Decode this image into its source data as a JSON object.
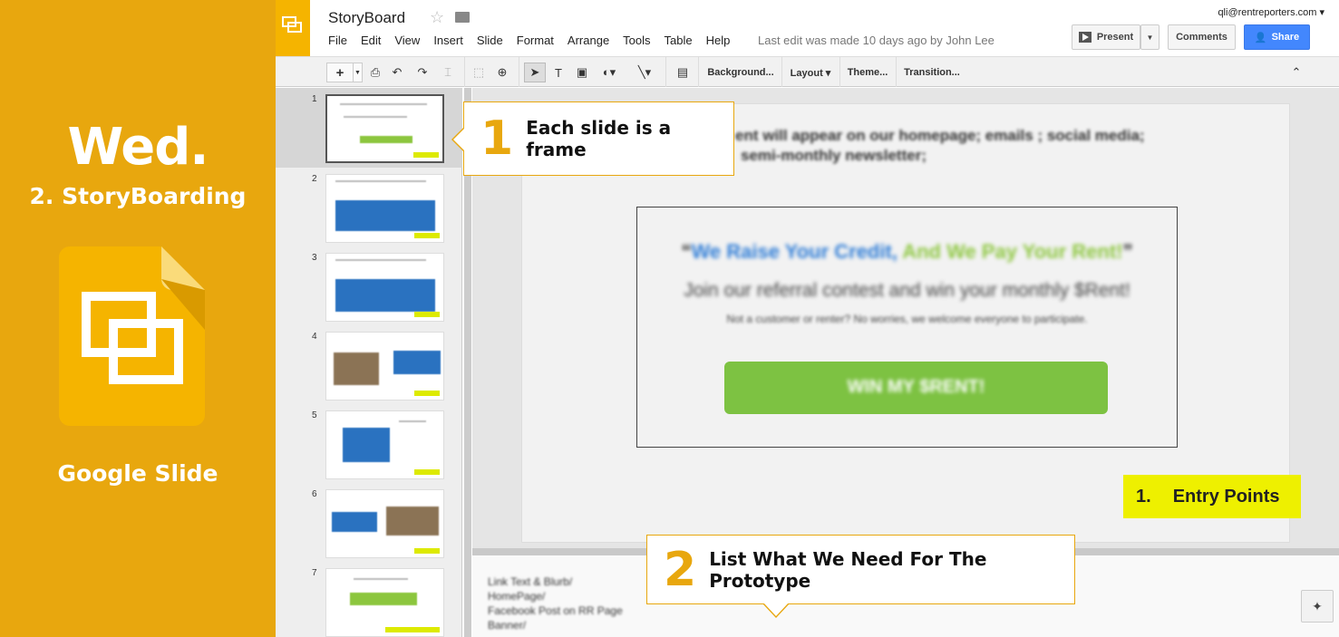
{
  "side": {
    "day": "Wed.",
    "subtitle": "2. StoryBoarding",
    "app_name": "Google Slide",
    "background": "#e8a70e"
  },
  "app": {
    "doc_title": "StoryBoard",
    "menu": [
      "File",
      "Edit",
      "View",
      "Insert",
      "Slide",
      "Format",
      "Arrange",
      "Tools",
      "Table",
      "Help"
    ],
    "last_edit": "Last edit was made 10 days ago by John Lee",
    "account": "qli@rentreporters.com ▾",
    "present_label": "Present",
    "comments_label": "Comments",
    "share_label": "Share",
    "share_color": "#4387fd"
  },
  "toolbar": {
    "add": "+",
    "background": "Background...",
    "layout": "Layout ▾",
    "theme": "Theme...",
    "transition": "Transition...",
    "collapse": "⌃"
  },
  "filmstrip": {
    "numbers": [
      "1",
      "2",
      "3",
      "4",
      "5",
      "6",
      "7"
    ]
  },
  "slide": {
    "heading_line1": "ent will appear on our homepage; emails ; social media;",
    "heading_line2": "semi-monthly newsletter;",
    "promo_headline_open": "“",
    "promo_headline_blue": "We Raise Your Credit,",
    "promo_headline_green": " And We Pay Your Rent!",
    "promo_headline_close": "”",
    "promo_sub": "Join our referral contest and win your monthly $Rent!",
    "promo_small": "Not a customer or renter? No worries, we welcome everyone to participate.",
    "promo_button": "WIN MY $RENT!",
    "entry_num": "1.",
    "entry_label": "Entry Points",
    "entry_color": "#eef000"
  },
  "notes": {
    "lines": [
      "Link Text & Blurb/",
      "HomePage/",
      "Facebook Post on RR Page",
      "Banner/"
    ]
  },
  "callouts": {
    "c1_num": "1",
    "c1_text": "Each slide is a frame",
    "c2_num": "2",
    "c2_text": "List What We Need For The Prototype"
  }
}
